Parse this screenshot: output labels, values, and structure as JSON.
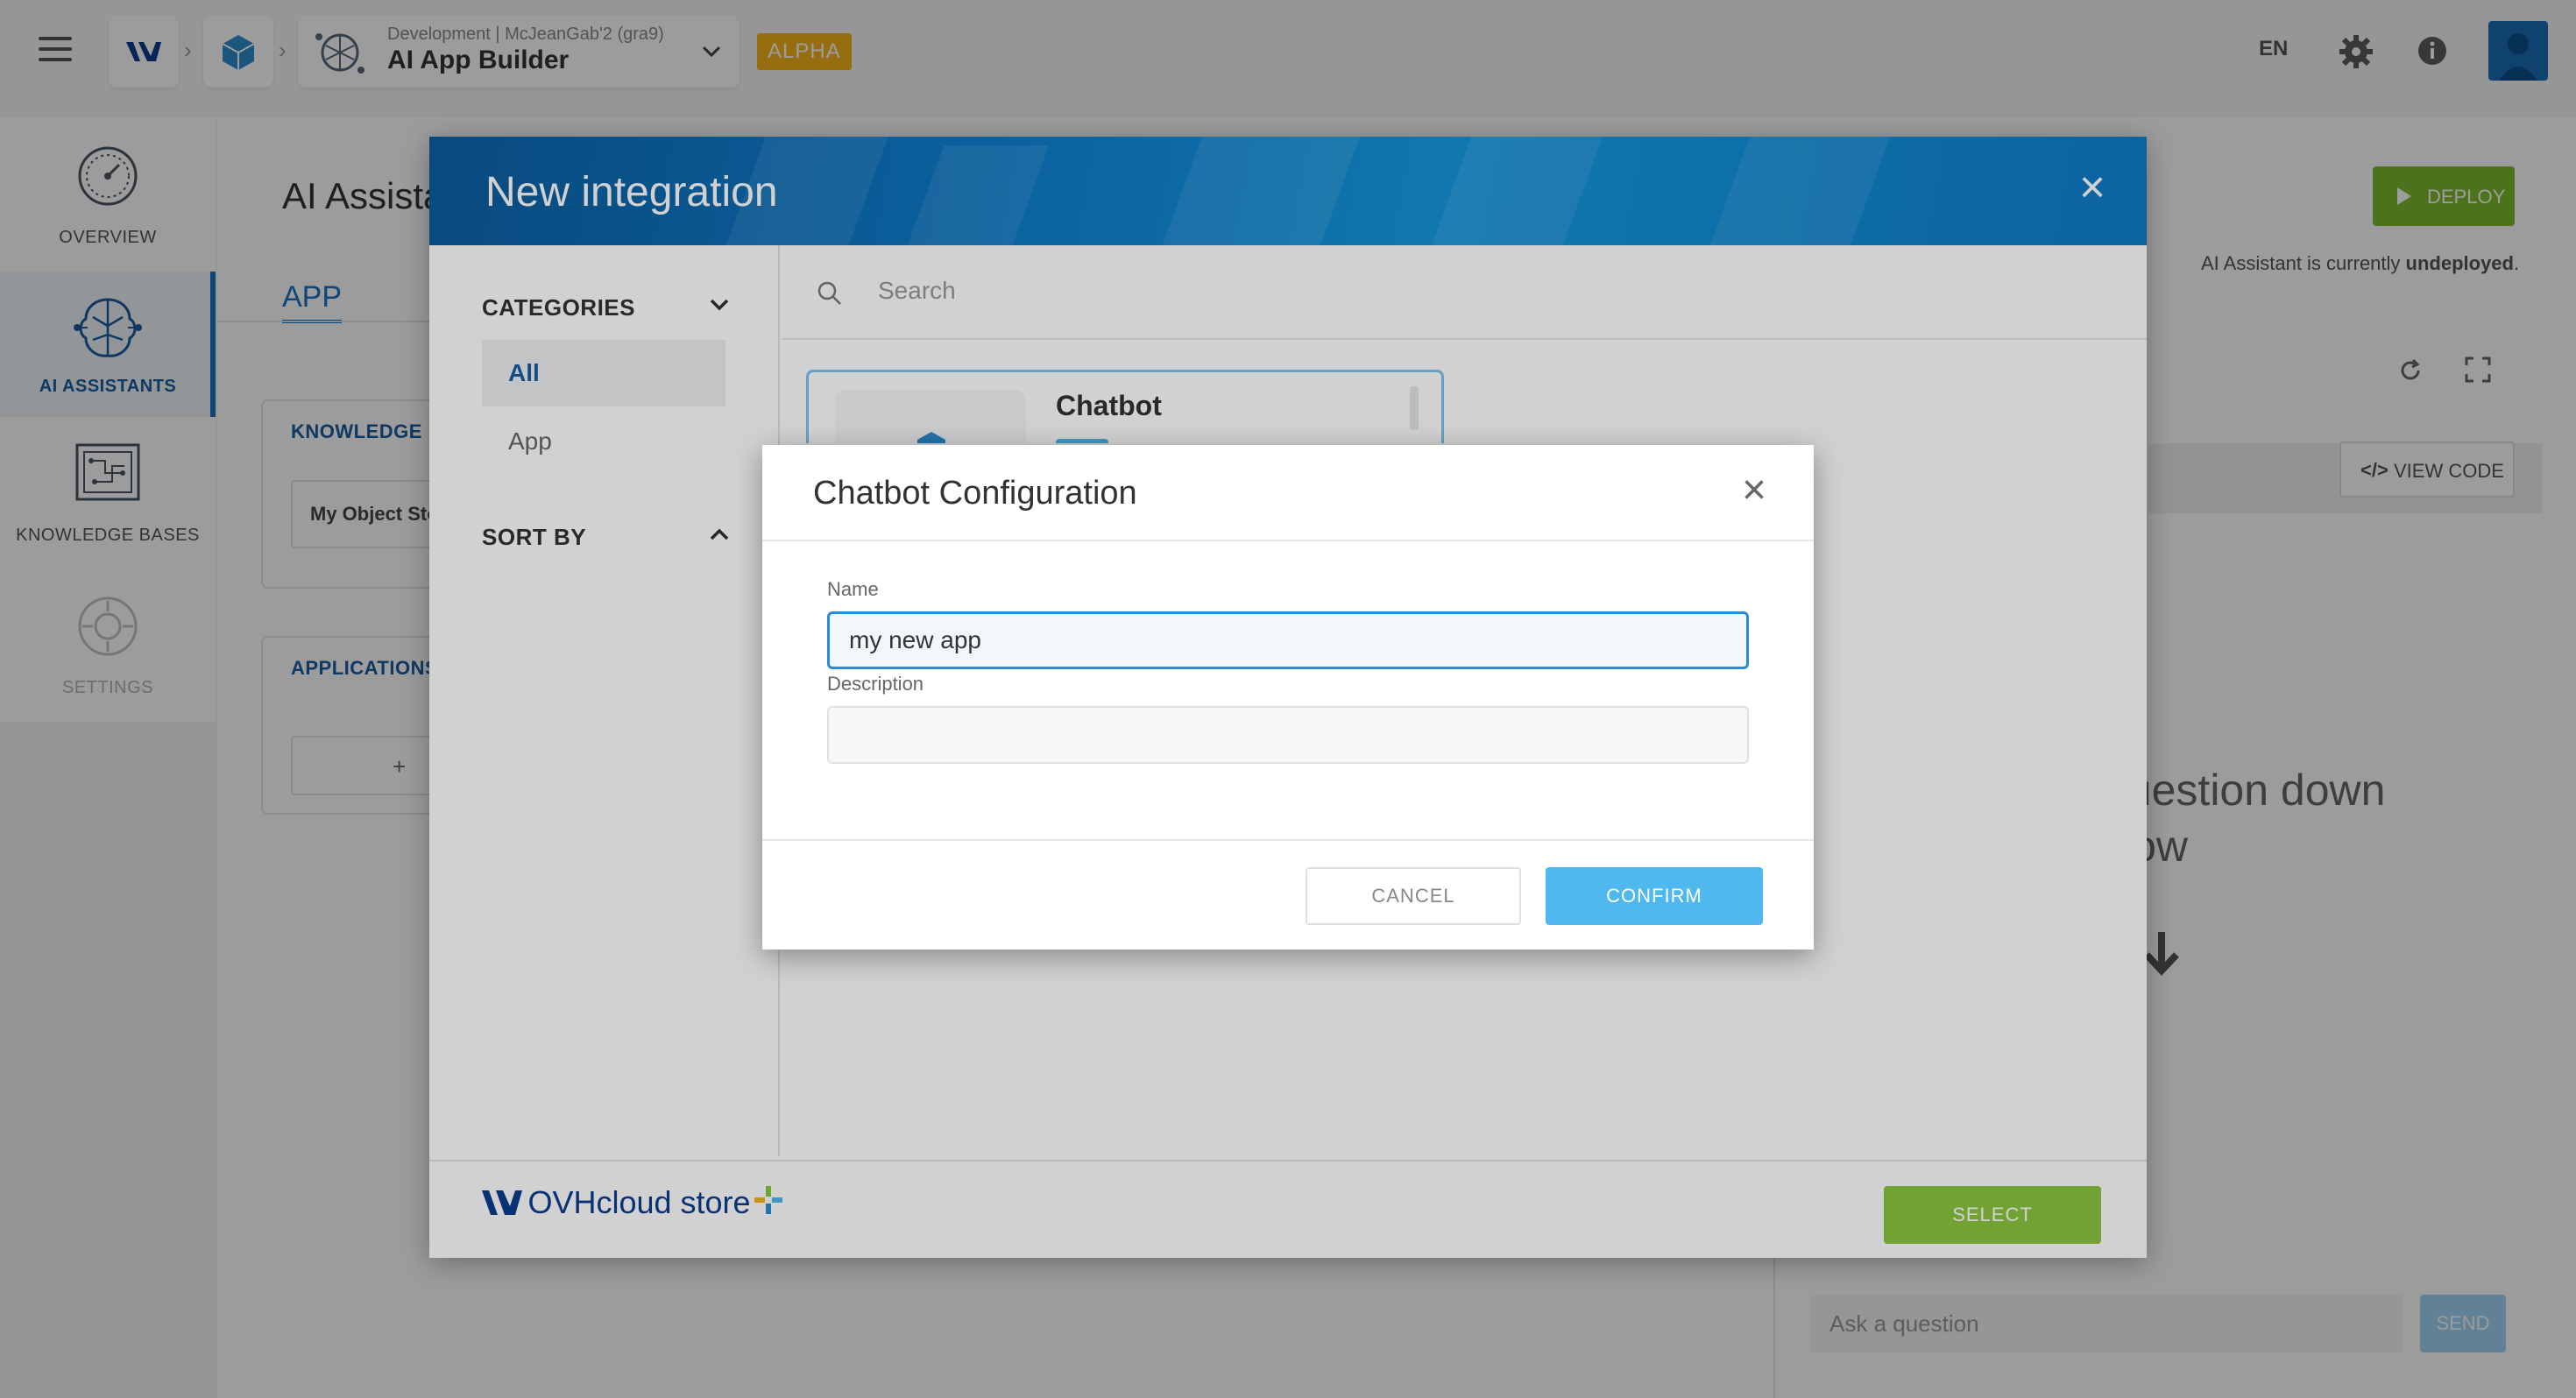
{
  "topbar": {
    "project_sub": "Development | McJeanGab'2 (gra9)",
    "project_title": "AI App Builder",
    "badge": "ALPHA",
    "language": "EN"
  },
  "leftnav": {
    "items": [
      {
        "label": "OVERVIEW",
        "icon": "gauge-icon"
      },
      {
        "label": "AI ASSISTANTS",
        "icon": "brain-icon"
      },
      {
        "label": "KNOWLEDGE BASES",
        "icon": "circuit-book-icon"
      },
      {
        "label": "SETTINGS",
        "icon": "gear-circle-icon"
      }
    ]
  },
  "background": {
    "title": "AI Assista",
    "tab": "APP",
    "knowledge_card_title": "KNOWLEDGE BA",
    "knowledge_select": "My Object Sto",
    "applications_card_title": "APPLICATIONS",
    "add_label": "+",
    "deploy_label": "DEPLOY",
    "status_prefix": "AI Assistant is currently ",
    "status_value": "undeployed",
    "status_suffix": ".",
    "view_code_label": "VIEW CODE",
    "chat_hint_line1": "question down",
    "chat_hint_line2": "low",
    "ask_placeholder": "Ask a question",
    "send_label": "SEND"
  },
  "integration_modal": {
    "title": "New integration",
    "categories_label": "CATEGORIES",
    "category_items": [
      "All",
      "App"
    ],
    "sort_by_label": "SORT BY",
    "search_placeholder": "Search",
    "card_title": "Chatbot",
    "store_name": "OVHcloud store",
    "select_label": "SELECT"
  },
  "config_dialog": {
    "title": "Chatbot Configuration",
    "name_label": "Name",
    "name_value": "my new app",
    "description_label": "Description",
    "description_value": "",
    "cancel_label": "CANCEL",
    "confirm_label": "CONFIRM"
  },
  "colors": {
    "accent_blue": "#1a73c2",
    "confirm_blue": "#4fb8ef",
    "select_green": "#8cc63f",
    "deploy_green": "#7cbd2c",
    "alpha_yellow": "#f6b41b"
  }
}
